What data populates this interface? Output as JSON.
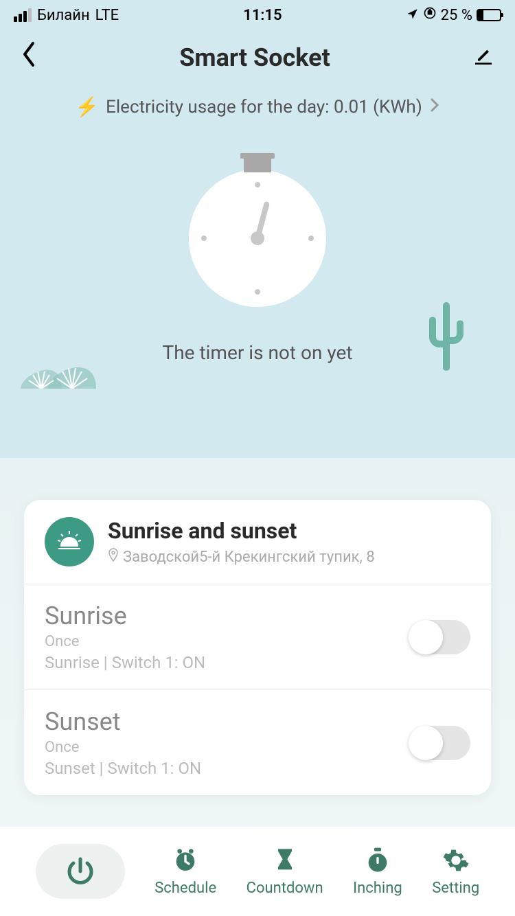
{
  "status": {
    "carrier": "Билайн",
    "network": "LTE",
    "time": "11:15",
    "battery_pct": "25 %"
  },
  "nav": {
    "title": "Smart Socket"
  },
  "usage": {
    "label": "Electricity usage for the day: 0.01 (KWh)"
  },
  "timer": {
    "status": "The timer is not on yet"
  },
  "card": {
    "title": "Sunrise and sunset",
    "location": "Заводской5-й Крекингский тупик, 8",
    "rows": [
      {
        "title": "Sunrise",
        "repeat": "Once",
        "detail": "Sunrise  | Switch 1: ON",
        "enabled": false
      },
      {
        "title": "Sunset",
        "repeat": "Once",
        "detail": "Sunset  | Switch 1: ON",
        "enabled": false
      }
    ]
  },
  "bottom_nav": {
    "items": [
      "Schedule",
      "Countdown",
      "Inching",
      "Setting"
    ]
  },
  "colors": {
    "accent": "#3d7a68",
    "sun_bg": "#3d9b84",
    "bolt": "#f5a623"
  }
}
